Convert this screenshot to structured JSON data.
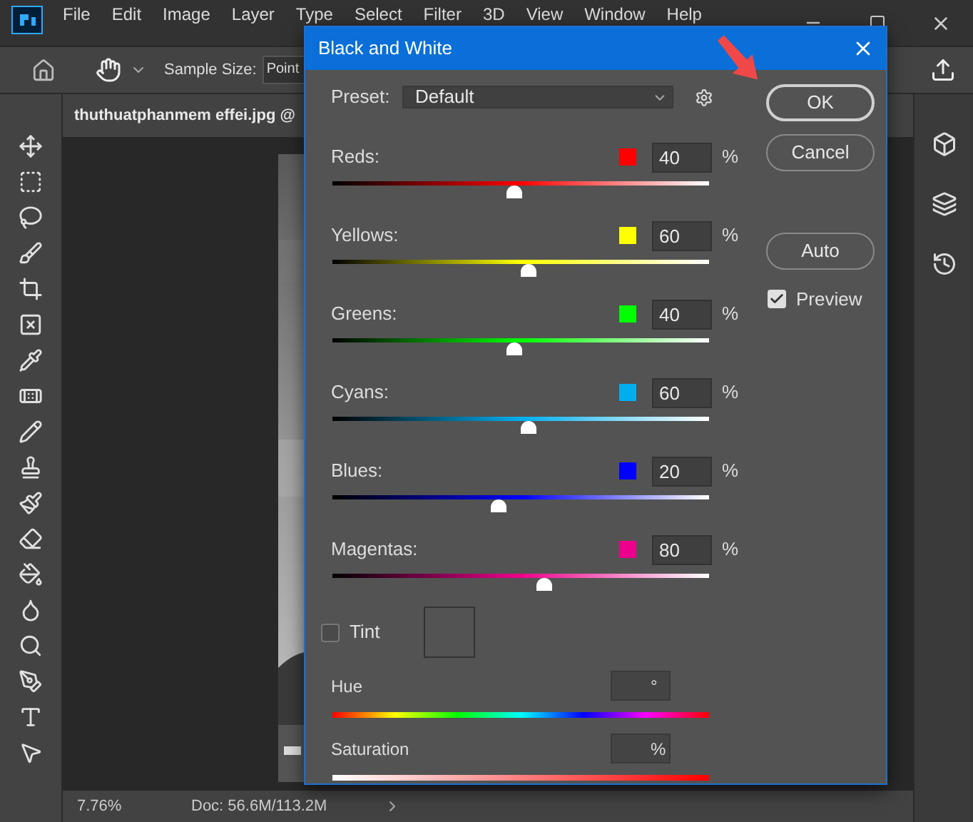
{
  "menu": [
    "File",
    "Edit",
    "Image",
    "Layer",
    "Type",
    "Select",
    "Filter",
    "3D",
    "View",
    "Window",
    "Help"
  ],
  "options_bar": {
    "sample_size_label": "Sample Size:",
    "sample_size_value": "Point"
  },
  "document_tab": "thuthuatphanmem effei.jpg @",
  "status_bar": {
    "zoom": "7.76%",
    "doc": "Doc: 56.6M/113.2M"
  },
  "dialog": {
    "title": "Black and White",
    "preset_label": "Preset:",
    "preset_value": "Default",
    "buttons": [
      {
        "label": "OK",
        "kind": "default"
      },
      {
        "label": "Cancel",
        "kind": "normal"
      },
      {
        "label": "Auto",
        "kind": "normal"
      }
    ],
    "preview": {
      "label": "Preview",
      "checked": true
    },
    "channels": [
      {
        "name": "Reds:",
        "color": "#ff0000",
        "value": "40",
        "unit": "%",
        "level": 0.48
      },
      {
        "name": "Yellows:",
        "color": "#ffff00",
        "value": "60",
        "unit": "%",
        "level": 0.52
      },
      {
        "name": "Greens:",
        "color": "#00ff00",
        "value": "40",
        "unit": "%",
        "level": 0.48
      },
      {
        "name": "Cyans:",
        "color": "#00aeef",
        "value": "60",
        "unit": "%",
        "level": 0.52
      },
      {
        "name": "Blues:",
        "color": "#0000ff",
        "value": "20",
        "unit": "%",
        "level": 0.44
      },
      {
        "name": "Magentas:",
        "color": "#ec008c",
        "value": "80",
        "unit": "%",
        "level": 0.56
      }
    ],
    "tint": {
      "label": "Tint",
      "checked": false
    },
    "hue": {
      "label": "Hue",
      "unit": "°"
    },
    "saturation": {
      "label": "Saturation",
      "unit": "%"
    }
  }
}
